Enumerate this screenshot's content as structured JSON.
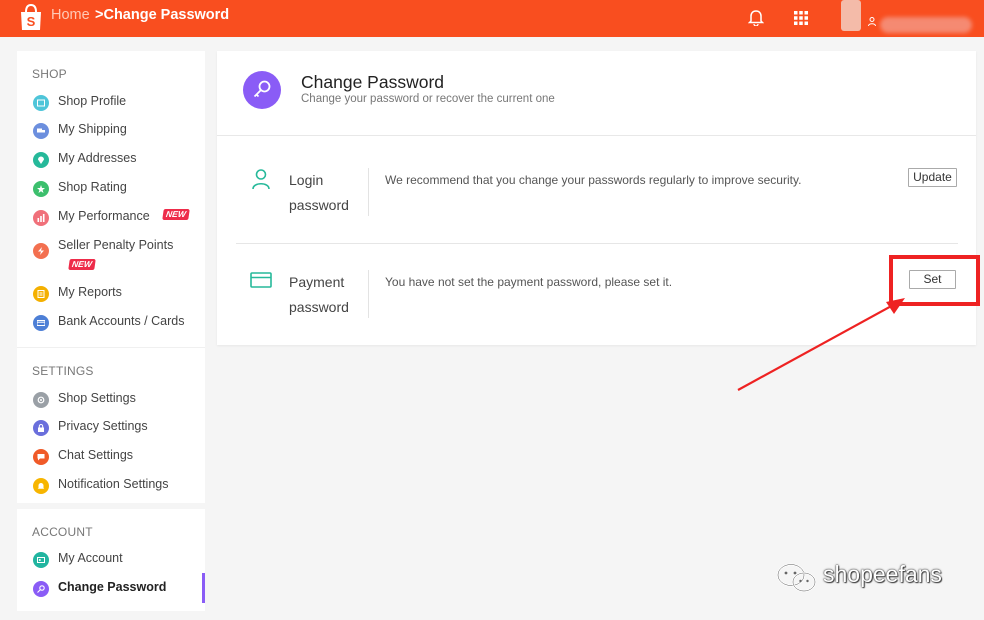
{
  "header": {
    "breadcrumb_home": "Home",
    "breadcrumb_current": ">Change Password",
    "brand_color": "#f94e1f"
  },
  "sidebar": {
    "sections": [
      {
        "heading": "SHOP",
        "items": [
          {
            "label": "Shop Profile",
            "icon": "store-icon",
            "color": "#4ec5d9"
          },
          {
            "label": "My Shipping",
            "icon": "truck-icon",
            "color": "#6c8fde"
          },
          {
            "label": "My Addresses",
            "icon": "location-pin-icon",
            "color": "#26b99a"
          },
          {
            "label": "Shop Rating",
            "icon": "star-icon",
            "color": "#3cbf6d"
          },
          {
            "label": "My Performance",
            "icon": "chart-icon",
            "color": "#f0707a",
            "badge": "NEW"
          },
          {
            "label": "Seller Penalty Points",
            "icon": "bolt-icon",
            "color": "#f37050",
            "badge": "NEW"
          },
          {
            "label": "My Reports",
            "icon": "report-icon",
            "color": "#f4b000"
          },
          {
            "label": "Bank Accounts / Cards",
            "icon": "card-icon",
            "color": "#4d7fd6"
          }
        ]
      },
      {
        "heading": "SETTINGS",
        "items": [
          {
            "label": "Shop Settings",
            "icon": "gear-icon",
            "color": "#9aa0a6"
          },
          {
            "label": "Privacy Settings",
            "icon": "lock-icon",
            "color": "#6a6fdc"
          },
          {
            "label": "Chat Settings",
            "icon": "chat-icon",
            "color": "#f05a28"
          },
          {
            "label": "Notification Settings",
            "icon": "bell-icon",
            "color": "#f7b500"
          }
        ]
      },
      {
        "heading": "ACCOUNT",
        "items": [
          {
            "label": "My Account",
            "icon": "id-card-icon",
            "color": "#21b5a0"
          },
          {
            "label": "Change Password",
            "icon": "key-icon",
            "color": "#8a5cf6",
            "active": true
          }
        ]
      }
    ]
  },
  "main": {
    "title": "Change Password",
    "subtitle": "Change your password or recover the current one",
    "rows": [
      {
        "label_line1": "Login",
        "label_line2": "password",
        "description": "We recommend that you change your passwords regularly to improve security.",
        "button": "Update",
        "icon": "user-icon"
      },
      {
        "label_line1": "Payment",
        "label_line2": "password",
        "description": "You have not set the payment password, please set it.",
        "button": "Set",
        "icon": "credit-card-icon"
      }
    ]
  },
  "watermark": {
    "text": "shopeefans"
  },
  "annotation_color": "#ee2222"
}
